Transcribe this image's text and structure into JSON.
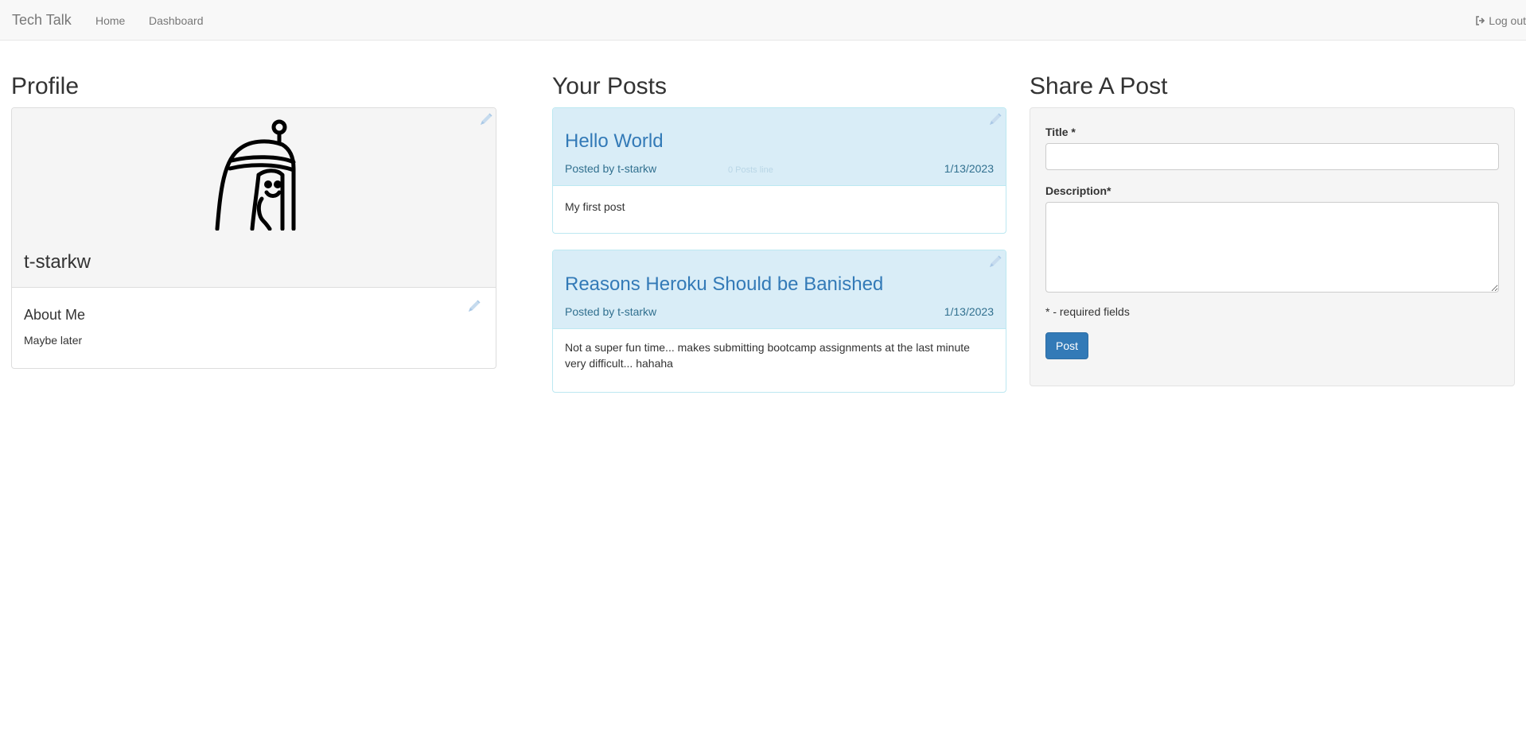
{
  "navbar": {
    "brand": "Tech Talk",
    "links": [
      "Home",
      "Dashboard"
    ],
    "logout_label": "Log out"
  },
  "profile": {
    "heading": "Profile",
    "username": "t-starkw",
    "about_title": "About Me",
    "about_text": "Maybe later"
  },
  "posts": {
    "heading": "Your Posts",
    "items": [
      {
        "title": "Hello World",
        "author": "Posted by t-starkw",
        "date": "1/13/2023",
        "body": "My first post",
        "faint_label": "0 Posts line"
      },
      {
        "title": "Reasons Heroku Should be Banished",
        "author": "Posted by t-starkw",
        "date": "1/13/2023",
        "body": "Not a super fun time... makes submitting bootcamp assignments at the last minute very difficult... hahaha"
      }
    ]
  },
  "share": {
    "heading": "Share A Post",
    "title_label": "Title *",
    "title_value": "",
    "description_label": "Description*",
    "description_value": "",
    "required_note": "* - required fields",
    "post_button": "Post"
  },
  "colors": {
    "accent": "#337ab7",
    "post_header_bg": "#d9edf7",
    "post_border": "#bce8f1",
    "panel_bg": "#f5f5f5",
    "navbar_bg": "#f8f8f8"
  },
  "icons": {
    "logout": "sign-out-icon",
    "edit": "pencil-icon",
    "avatar": "princess-bubblegum-avatar"
  }
}
